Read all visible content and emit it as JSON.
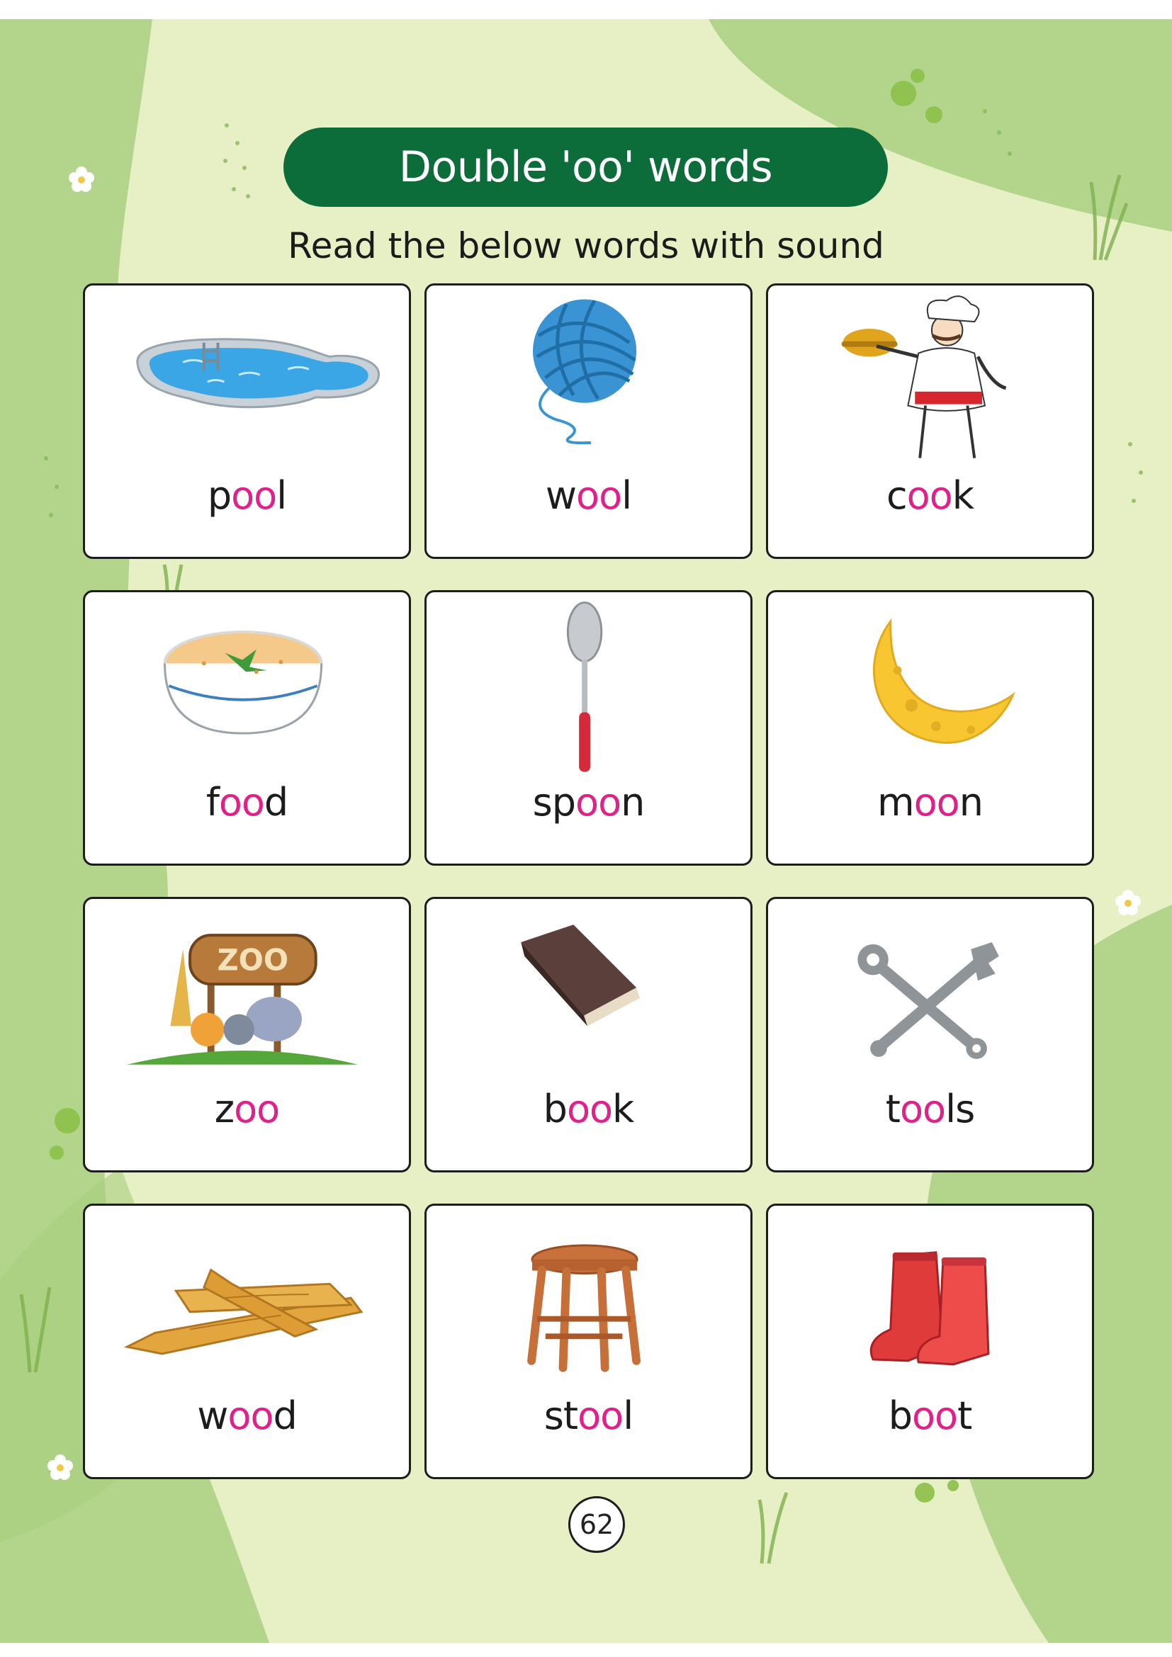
{
  "title": "Double 'oo' words",
  "subtitle": "Read the below words with sound",
  "page_number": "62",
  "highlight_color": "#e0218a",
  "banner_color": "#0d6d3a",
  "cards": [
    {
      "word": "pool",
      "parts": [
        "p",
        "oo",
        "l"
      ],
      "icon": "swimming-pool-icon"
    },
    {
      "word": "wool",
      "parts": [
        "w",
        "oo",
        "l"
      ],
      "icon": "yarn-ball-icon"
    },
    {
      "word": "cook",
      "parts": [
        "c",
        "oo",
        "k"
      ],
      "icon": "chef-icon"
    },
    {
      "word": "food",
      "parts": [
        "f",
        "oo",
        "d"
      ],
      "icon": "soup-bowl-icon"
    },
    {
      "word": "spoon",
      "parts": [
        "sp",
        "oo",
        "n"
      ],
      "icon": "spoon-icon"
    },
    {
      "word": "moon",
      "parts": [
        "m",
        "oo",
        "n"
      ],
      "icon": "crescent-moon-icon"
    },
    {
      "word": "zoo",
      "parts": [
        "z",
        "oo",
        ""
      ],
      "icon": "zoo-sign-icon"
    },
    {
      "word": "book",
      "parts": [
        "b",
        "oo",
        "k"
      ],
      "icon": "book-icon"
    },
    {
      "word": "tools",
      "parts": [
        "t",
        "oo",
        "ls"
      ],
      "icon": "wrench-tools-icon"
    },
    {
      "word": "wood",
      "parts": [
        "w",
        "oo",
        "d"
      ],
      "icon": "wood-planks-icon"
    },
    {
      "word": "stool",
      "parts": [
        "st",
        "oo",
        "l"
      ],
      "icon": "stool-icon"
    },
    {
      "word": "boot",
      "parts": [
        "b",
        "oo",
        "t"
      ],
      "icon": "boots-icon"
    }
  ]
}
